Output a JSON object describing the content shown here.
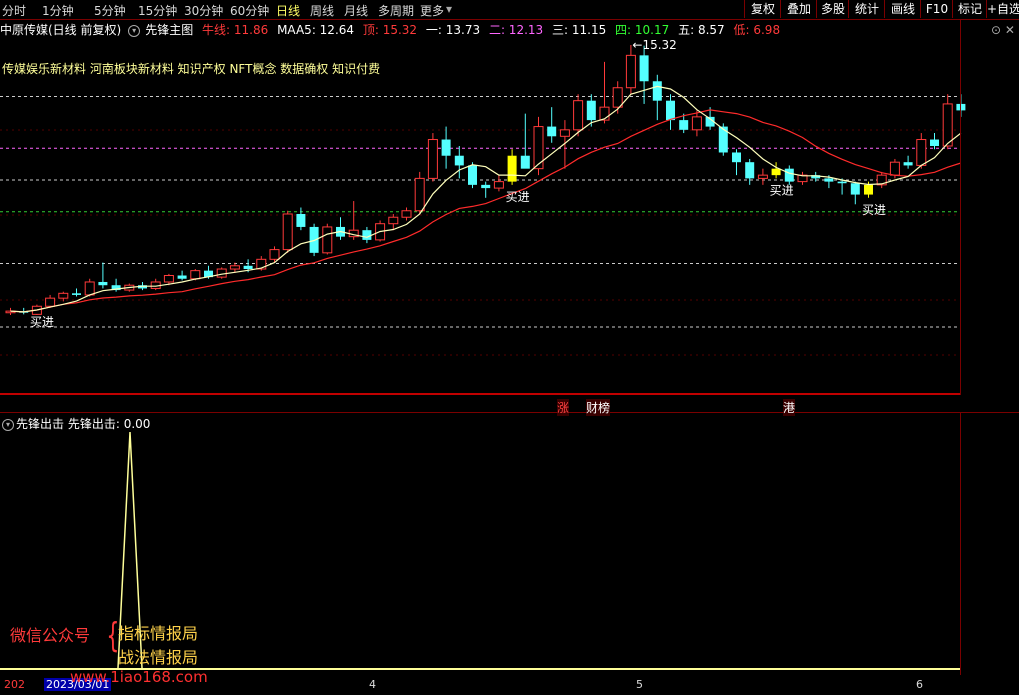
{
  "toolbar": {
    "timeframes": [
      "分时",
      "1分钟",
      "5分钟",
      "15分钟",
      "30分钟",
      "60分钟",
      "日线",
      "周线",
      "月线",
      "多周期",
      "更多"
    ],
    "active": "日线",
    "right_buttons": [
      "复权",
      "叠加",
      "多股",
      "统计",
      "画线",
      "F10",
      "标记",
      "+自选"
    ]
  },
  "legend": {
    "stock": "中原传媒(日线 前复权)",
    "indicator": "先锋主图",
    "niu_label": "牛线: 11.86",
    "maa5": "MAA5: 12.64",
    "ding": "顶: 15.32",
    "yi": "一: 13.73",
    "er": "二: 12.13",
    "san": "三: 11.15",
    "si": "四: 10.17",
    "wu": "五: 8.57",
    "di": "低: 6.98"
  },
  "concepts": "传媒娱乐新材料 河南板块新材料 知识产权 NFT概念 数据确权 知识付费",
  "annotations": {
    "buy": "买进",
    "high": "15.32",
    "zhang": "涨",
    "caibang": "财榜",
    "gang": "港"
  },
  "subpanel": {
    "name": "先锋出击",
    "value": "先锋出击: 0.00"
  },
  "watermark": {
    "left": "微信公众号",
    "line1": "指标情报局",
    "line2": "战法情报局",
    "site": "www.1iao168.com"
  },
  "datebar": {
    "selected": "2023/03/01",
    "prefix": "202",
    "month4": "4",
    "month5": "5",
    "month6": "6"
  },
  "colors": {
    "up": "#ff3a3a",
    "down": "#54ffff",
    "ma5": "#ffffbb",
    "ma_slow": "#ff2b2b",
    "buy": "#ffff00",
    "grid_white": "#cccccc",
    "grid_magenta": "#ff66ff",
    "grid_green": "#33cc33",
    "border": "#b00000"
  },
  "chart_data": {
    "type": "candlestick",
    "price_ylim": [
      6.98,
      15.32
    ],
    "levels": {
      "ding": 15.32,
      "yi": 13.73,
      "er": 12.13,
      "san": 11.15,
      "si": 10.17,
      "wu": 8.57,
      "di": 6.98
    },
    "candles": [
      {
        "o": 7.05,
        "h": 7.2,
        "l": 6.98,
        "c": 7.1
      },
      {
        "o": 7.1,
        "h": 7.2,
        "l": 7.0,
        "c": 7.05
      },
      {
        "o": 7.0,
        "h": 7.3,
        "l": 6.98,
        "c": 7.25
      },
      {
        "o": 7.25,
        "h": 7.6,
        "l": 7.2,
        "c": 7.5
      },
      {
        "o": 7.5,
        "h": 7.7,
        "l": 7.4,
        "c": 7.65
      },
      {
        "o": 7.65,
        "h": 7.8,
        "l": 7.55,
        "c": 7.6
      },
      {
        "o": 7.6,
        "h": 8.1,
        "l": 7.55,
        "c": 8.0
      },
      {
        "o": 8.0,
        "h": 8.6,
        "l": 7.8,
        "c": 7.9
      },
      {
        "o": 7.9,
        "h": 8.1,
        "l": 7.7,
        "c": 7.75
      },
      {
        "o": 7.75,
        "h": 7.95,
        "l": 7.7,
        "c": 7.9
      },
      {
        "o": 7.9,
        "h": 8.0,
        "l": 7.75,
        "c": 7.8
      },
      {
        "o": 7.8,
        "h": 8.1,
        "l": 7.75,
        "c": 8.0
      },
      {
        "o": 8.0,
        "h": 8.25,
        "l": 7.9,
        "c": 8.2
      },
      {
        "o": 8.2,
        "h": 8.35,
        "l": 8.05,
        "c": 8.1
      },
      {
        "o": 8.1,
        "h": 8.4,
        "l": 8.05,
        "c": 8.35
      },
      {
        "o": 8.35,
        "h": 8.5,
        "l": 8.1,
        "c": 8.15
      },
      {
        "o": 8.15,
        "h": 8.45,
        "l": 8.1,
        "c": 8.4
      },
      {
        "o": 8.4,
        "h": 8.6,
        "l": 8.3,
        "c": 8.5
      },
      {
        "o": 8.5,
        "h": 8.7,
        "l": 8.3,
        "c": 8.4
      },
      {
        "o": 8.4,
        "h": 8.8,
        "l": 8.35,
        "c": 8.7
      },
      {
        "o": 8.7,
        "h": 9.1,
        "l": 8.6,
        "c": 9.0
      },
      {
        "o": 9.0,
        "h": 10.2,
        "l": 8.9,
        "c": 10.1
      },
      {
        "o": 10.1,
        "h": 10.3,
        "l": 9.6,
        "c": 9.7
      },
      {
        "o": 9.7,
        "h": 9.8,
        "l": 8.8,
        "c": 8.9
      },
      {
        "o": 8.9,
        "h": 9.8,
        "l": 8.85,
        "c": 9.7
      },
      {
        "o": 9.7,
        "h": 10.0,
        "l": 9.3,
        "c": 9.4
      },
      {
        "o": 9.4,
        "h": 10.5,
        "l": 9.3,
        "c": 9.6
      },
      {
        "o": 9.6,
        "h": 9.7,
        "l": 9.2,
        "c": 9.3
      },
      {
        "o": 9.3,
        "h": 9.9,
        "l": 9.25,
        "c": 9.8
      },
      {
        "o": 9.8,
        "h": 10.1,
        "l": 9.6,
        "c": 10.0
      },
      {
        "o": 10.0,
        "h": 10.3,
        "l": 9.9,
        "c": 10.2
      },
      {
        "o": 10.2,
        "h": 11.4,
        "l": 10.1,
        "c": 11.2
      },
      {
        "o": 11.2,
        "h": 12.6,
        "l": 11.1,
        "c": 12.4
      },
      {
        "o": 12.4,
        "h": 12.8,
        "l": 11.5,
        "c": 11.9
      },
      {
        "o": 11.9,
        "h": 12.2,
        "l": 11.2,
        "c": 11.6
      },
      {
        "o": 11.6,
        "h": 11.7,
        "l": 10.9,
        "c": 11.0
      },
      {
        "o": 11.0,
        "h": 11.1,
        "l": 10.6,
        "c": 10.9
      },
      {
        "o": 10.9,
        "h": 11.3,
        "l": 10.8,
        "c": 11.1
      },
      {
        "o": 11.1,
        "h": 12.1,
        "l": 11.0,
        "c": 11.9,
        "buy": true
      },
      {
        "o": 11.9,
        "h": 13.2,
        "l": 11.6,
        "c": 11.5
      },
      {
        "o": 11.5,
        "h": 13.1,
        "l": 11.3,
        "c": 12.8
      },
      {
        "o": 12.8,
        "h": 13.4,
        "l": 12.3,
        "c": 12.5
      },
      {
        "o": 12.5,
        "h": 13.0,
        "l": 11.5,
        "c": 12.7
      },
      {
        "o": 12.7,
        "h": 13.8,
        "l": 12.5,
        "c": 13.6
      },
      {
        "o": 13.6,
        "h": 13.8,
        "l": 12.8,
        "c": 13.0
      },
      {
        "o": 13.0,
        "h": 14.8,
        "l": 12.9,
        "c": 13.4
      },
      {
        "o": 13.4,
        "h": 14.2,
        "l": 13.2,
        "c": 14.0
      },
      {
        "o": 14.0,
        "h": 15.32,
        "l": 13.8,
        "c": 15.0
      },
      {
        "o": 15.0,
        "h": 15.3,
        "l": 13.5,
        "c": 14.2
      },
      {
        "o": 14.2,
        "h": 14.4,
        "l": 13.0,
        "c": 13.6
      },
      {
        "o": 13.6,
        "h": 13.8,
        "l": 12.7,
        "c": 13.0
      },
      {
        "o": 13.0,
        "h": 13.2,
        "l": 12.6,
        "c": 12.7
      },
      {
        "o": 12.7,
        "h": 13.3,
        "l": 12.5,
        "c": 13.1
      },
      {
        "o": 13.1,
        "h": 13.4,
        "l": 12.7,
        "c": 12.8
      },
      {
        "o": 12.8,
        "h": 12.9,
        "l": 11.9,
        "c": 12.0
      },
      {
        "o": 12.0,
        "h": 12.1,
        "l": 11.3,
        "c": 11.7
      },
      {
        "o": 11.7,
        "h": 11.8,
        "l": 11.0,
        "c": 11.2
      },
      {
        "o": 11.2,
        "h": 11.5,
        "l": 11.0,
        "c": 11.3
      },
      {
        "o": 11.3,
        "h": 11.7,
        "l": 11.2,
        "c": 11.5,
        "buy": true
      },
      {
        "o": 11.5,
        "h": 11.6,
        "l": 11.0,
        "c": 11.1
      },
      {
        "o": 11.1,
        "h": 11.4,
        "l": 11.0,
        "c": 11.3
      },
      {
        "o": 11.3,
        "h": 11.4,
        "l": 11.1,
        "c": 11.2
      },
      {
        "o": 11.2,
        "h": 11.3,
        "l": 10.9,
        "c": 11.1
      },
      {
        "o": 11.1,
        "h": 11.2,
        "l": 10.7,
        "c": 11.05
      },
      {
        "o": 11.05,
        "h": 11.1,
        "l": 10.4,
        "c": 10.7
      },
      {
        "o": 10.7,
        "h": 11.1,
        "l": 10.6,
        "c": 11.0,
        "buy": true
      },
      {
        "o": 11.0,
        "h": 11.4,
        "l": 10.9,
        "c": 11.3
      },
      {
        "o": 11.3,
        "h": 11.8,
        "l": 11.2,
        "c": 11.7
      },
      {
        "o": 11.7,
        "h": 11.9,
        "l": 11.5,
        "c": 11.6
      },
      {
        "o": 11.6,
        "h": 12.6,
        "l": 11.5,
        "c": 12.4
      },
      {
        "o": 12.4,
        "h": 12.6,
        "l": 12.1,
        "c": 12.2
      },
      {
        "o": 12.2,
        "h": 13.8,
        "l": 12.1,
        "c": 13.5
      },
      {
        "o": 13.5,
        "h": 13.8,
        "l": 13.1,
        "c": 13.3
      }
    ],
    "signal": {
      "peak_index": 9,
      "peak_value": 1,
      "current": 0.0
    }
  }
}
